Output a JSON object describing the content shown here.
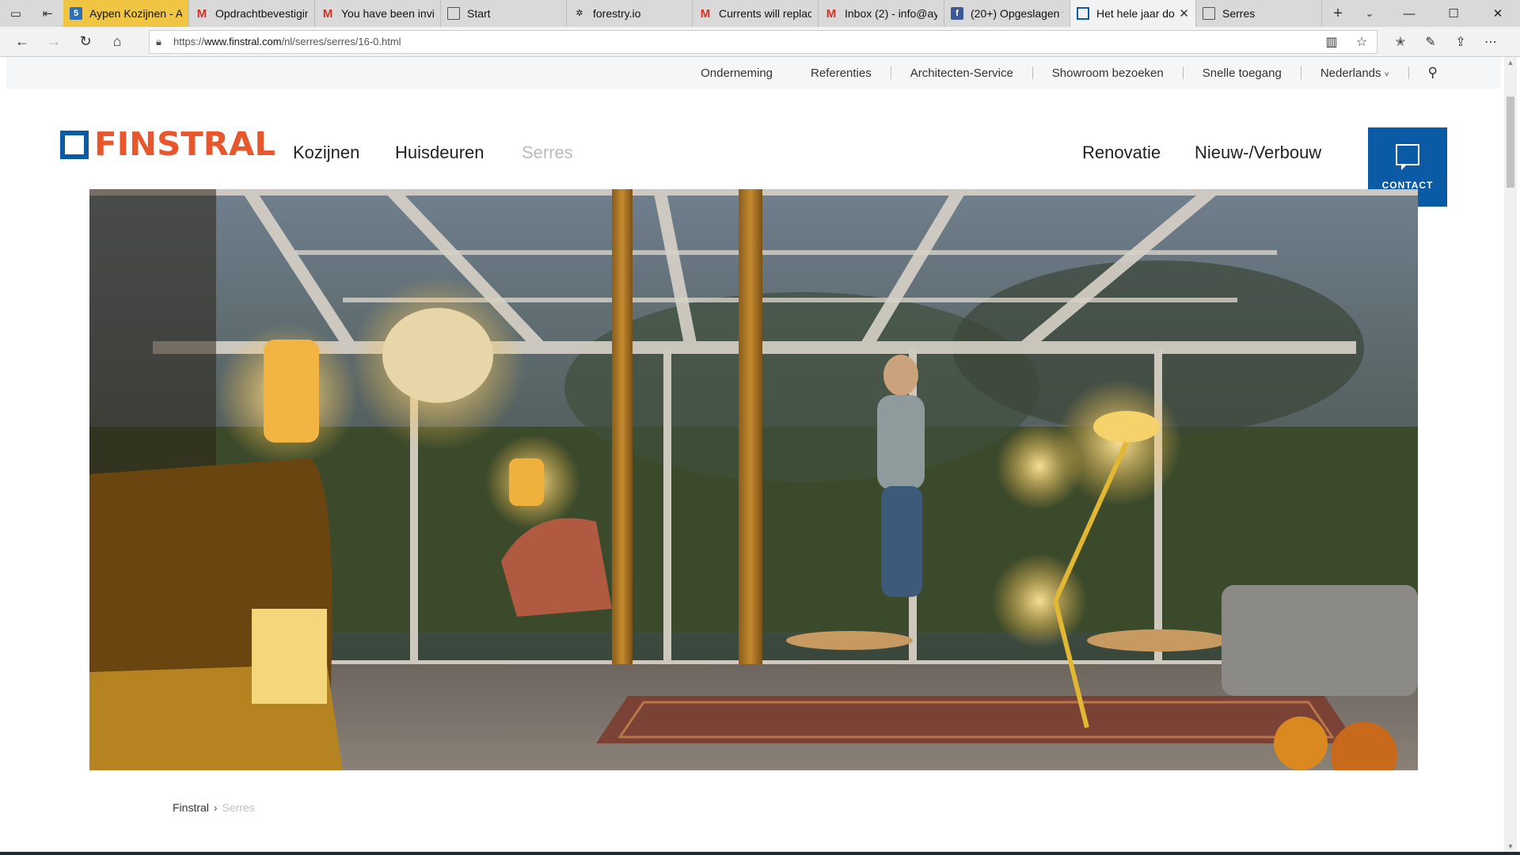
{
  "browser": {
    "tabs": [
      {
        "title": "Aypen Kozijnen - Ag",
        "icon": "five-icon",
        "state": "highlight"
      },
      {
        "title": "Opdrachtbevestiging",
        "icon": "gmail-icon",
        "state": "normal"
      },
      {
        "title": "You have been invite",
        "icon": "gmail-icon",
        "state": "normal"
      },
      {
        "title": "Start",
        "icon": "page-icon",
        "state": "normal"
      },
      {
        "title": "forestry.io",
        "icon": "tree-icon",
        "state": "normal"
      },
      {
        "title": "Currents will replace",
        "icon": "gmail-icon",
        "state": "normal"
      },
      {
        "title": "Inbox (2) - info@ayp",
        "icon": "gmail-icon",
        "state": "normal"
      },
      {
        "title": "(20+) Opgeslagen vi",
        "icon": "facebook-icon",
        "state": "normal"
      },
      {
        "title": "Het hele jaar do",
        "icon": "finstral-icon",
        "state": "active"
      },
      {
        "title": "Serres",
        "icon": "page-icon",
        "state": "normal"
      }
    ],
    "url_prefix": "https://",
    "url_host": "www.finstral.com",
    "url_path": "/nl/serres/serres/16-0.html"
  },
  "utility_nav": {
    "items": [
      "Onderneming",
      "Referenties",
      "Architecten-Service",
      "Showroom bezoeken",
      "Snelle toegang"
    ],
    "language": "Nederlands"
  },
  "logo": {
    "text": "FINSTRAL"
  },
  "main_nav": {
    "kozijnen": "Kozijnen",
    "huisdeuren": "Huisdeuren",
    "serres": "Serres",
    "renovatie": "Renovatie",
    "nieuw": "Nieuw-/Verbouw"
  },
  "contact": {
    "label": "CONTACT"
  },
  "breadcrumb": {
    "home": "Finstral",
    "current": "Serres"
  },
  "colors": {
    "brand_blue": "#0a5aa6",
    "brand_orange": "#e8562b",
    "active_nav": "#bbbbbb"
  }
}
